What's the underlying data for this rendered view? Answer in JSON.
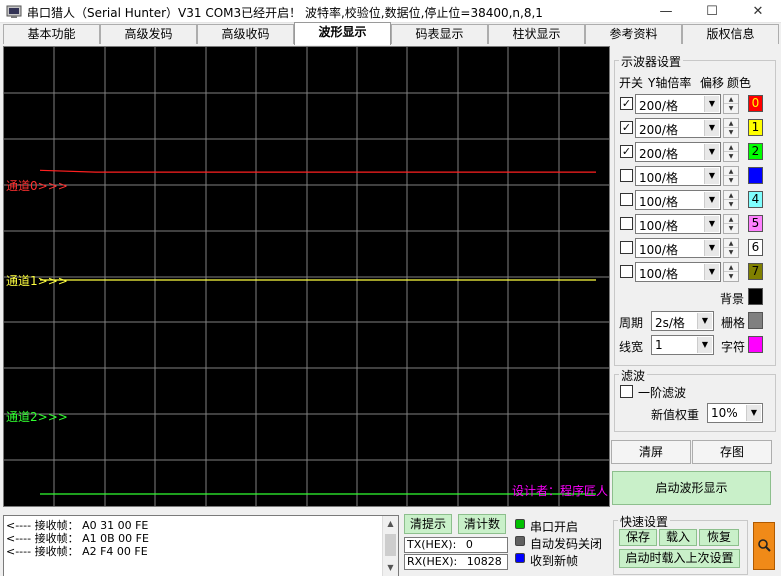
{
  "window": {
    "title": "串口猎人（Serial Hunter）V31    COM3已经开启！ 波特率,校验位,数据位,停止位=38400,n,8,1",
    "minimize_glyph": "—",
    "maximize_glyph": "☐",
    "close_glyph": "✕"
  },
  "tabs": [
    {
      "label": "基本功能"
    },
    {
      "label": "高级发码"
    },
    {
      "label": "高级收码"
    },
    {
      "label": "波形显示"
    },
    {
      "label": "码表显示"
    },
    {
      "label": "柱状显示"
    },
    {
      "label": "参考资料"
    },
    {
      "label": "版权信息"
    }
  ],
  "active_tab": "波形显示",
  "scope": {
    "background": "#000000",
    "grid_color": "#808080",
    "channel_labels": [
      "通道0>>>",
      "通道1>>>",
      "通道2>>>"
    ],
    "designer": "设计者：程序匠人",
    "designer_color": "#ff00ff"
  },
  "chart_data": {
    "type": "line",
    "series": [
      {
        "name": "通道0",
        "color": "#ff2020",
        "values": [
          0.32,
          0.28,
          0.28,
          0.28,
          0.28,
          0.28,
          0.28,
          0.28,
          0.28,
          0.28,
          0.28
        ]
      },
      {
        "name": "通道1",
        "color": "#ffff40",
        "values": [
          0.0,
          0.0,
          0.0,
          0.0,
          0.0,
          0.0,
          0.0,
          0.0,
          0.0,
          0.0,
          0.0
        ]
      },
      {
        "name": "通道2",
        "color": "#30ff30",
        "values": [
          -1.7,
          -1.7,
          -1.7,
          -1.7,
          -1.7,
          -1.7,
          -1.7,
          -1.7,
          -1.7,
          -1.7,
          -1.7
        ]
      }
    ],
    "grid": true
  },
  "oscilloscope_settings": {
    "title": "示波器设置",
    "headers": {
      "switch": "开关",
      "y_scale": "Y轴倍率",
      "offset": "偏移",
      "color": "颜色"
    },
    "channels": [
      {
        "checked": true,
        "scale": "200/格",
        "color": "#ff0000",
        "label": "0",
        "label_color": "#ffff00"
      },
      {
        "checked": true,
        "scale": "200/格",
        "color": "#ffff00",
        "label": "1",
        "label_color": "#000000"
      },
      {
        "checked": true,
        "scale": "200/格",
        "color": "#00ff00",
        "label": "2",
        "label_color": "#000000"
      },
      {
        "checked": false,
        "scale": "100/格",
        "color": "#0000ff",
        "label": "3",
        "label_color": "#0000ff"
      },
      {
        "checked": false,
        "scale": "100/格",
        "color": "#80ffff",
        "label": "4",
        "label_color": "#000000"
      },
      {
        "checked": false,
        "scale": "100/格",
        "color": "#ff80ff",
        "label": "5",
        "label_color": "#000000"
      },
      {
        "checked": false,
        "scale": "100/格",
        "color": "#ffffff",
        "label": "6",
        "label_color": "#000000"
      },
      {
        "checked": false,
        "scale": "100/格",
        "color": "#808000",
        "label": "7",
        "label_color": "#000000"
      }
    ],
    "check_glyph": "✓",
    "background_label": "背景",
    "background_color": "#000000",
    "period_label": "周期",
    "period_value": "2s/格",
    "grid_label": "栅格",
    "grid_color": "#808080",
    "line_width_label": "线宽",
    "line_width_value": "1",
    "font_label": "字符",
    "font_color": "#ff00ff"
  },
  "filter": {
    "title": "滤波",
    "first_order_label": "一阶滤波",
    "first_order_checked": false,
    "weight_label": "新值权重",
    "weight_value": "10%"
  },
  "actions": {
    "clear_label": "清屏",
    "save_label": "存图",
    "start_label": "启动波形显示"
  },
  "receive_log": [
    "<---- 接收帧： A0 31 00 FE",
    "<---- 接收帧： A1 0B 00 FE",
    "<---- 接收帧： A2 F4 00 FE"
  ],
  "counters": {
    "clear_tip_label": "清提示",
    "clear_count_label": "清计数",
    "tx_label": "TX(HEX):",
    "tx_value": "0",
    "rx_label": "RX(HEX):",
    "rx_value": "10828"
  },
  "status": [
    {
      "label": "串口开启",
      "color": "#00c000"
    },
    {
      "label": "自动发码关闭",
      "color": "#606060"
    },
    {
      "label": "收到新帧",
      "color": "#0000ff"
    }
  ],
  "quick_settings": {
    "title": "快速设置",
    "save_label": "保存",
    "load_label": "载入",
    "restore_label": "恢复",
    "startup_label": "启动时载入上次设置"
  },
  "icons": {
    "dropdown": "▼",
    "spin_up": "▲",
    "spin_down": "▼",
    "scroll_up": "▲",
    "scroll_down": "▼"
  }
}
